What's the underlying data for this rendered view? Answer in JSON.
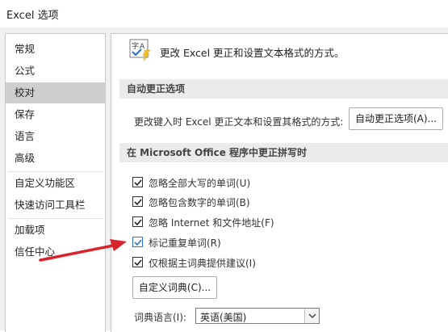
{
  "window": {
    "title": "Excel 选项"
  },
  "sidebar": {
    "items": [
      {
        "label": "常规"
      },
      {
        "label": "公式"
      },
      {
        "label": "校对"
      },
      {
        "label": "保存"
      },
      {
        "label": "语言"
      },
      {
        "label": "高级"
      },
      {
        "label": "自定义功能区"
      },
      {
        "label": "快速访问工具栏"
      },
      {
        "label": "加载项"
      },
      {
        "label": "信任中心"
      }
    ],
    "active_item": "校对"
  },
  "content": {
    "intro_text": "更改 Excel 更正和设置文本格式的方式。",
    "autocorrect": {
      "header": "自动更正选项",
      "description": "更改键入时 Excel 更正文本和设置其格式的方式:",
      "button_label": "自动更正选项(A)..."
    },
    "spelling": {
      "header": "在 Microsoft Office 程序中更正拼写时",
      "options": [
        {
          "label": "忽略全部大写的单词(U)",
          "checked": true
        },
        {
          "label": "忽略包含数字的单词(B)",
          "checked": true
        },
        {
          "label": "忽略 Internet 和文件地址(F)",
          "checked": true
        },
        {
          "label": "标记重复单词(R)",
          "checked": true
        },
        {
          "label": "仅根据主词典提供建议(I)",
          "checked": true
        }
      ],
      "custom_dict_button": "自定义词典(C)...",
      "dict_language_label": "词典语言(I):",
      "dict_language_value": "英语(美国)"
    }
  },
  "annotation": {
    "arrow_color": "#d9232a"
  },
  "icons": {
    "proofing": "abc-check-icon",
    "checkbox_mark": "checkmark-icon",
    "dropdown": "chevron-down-icon"
  }
}
